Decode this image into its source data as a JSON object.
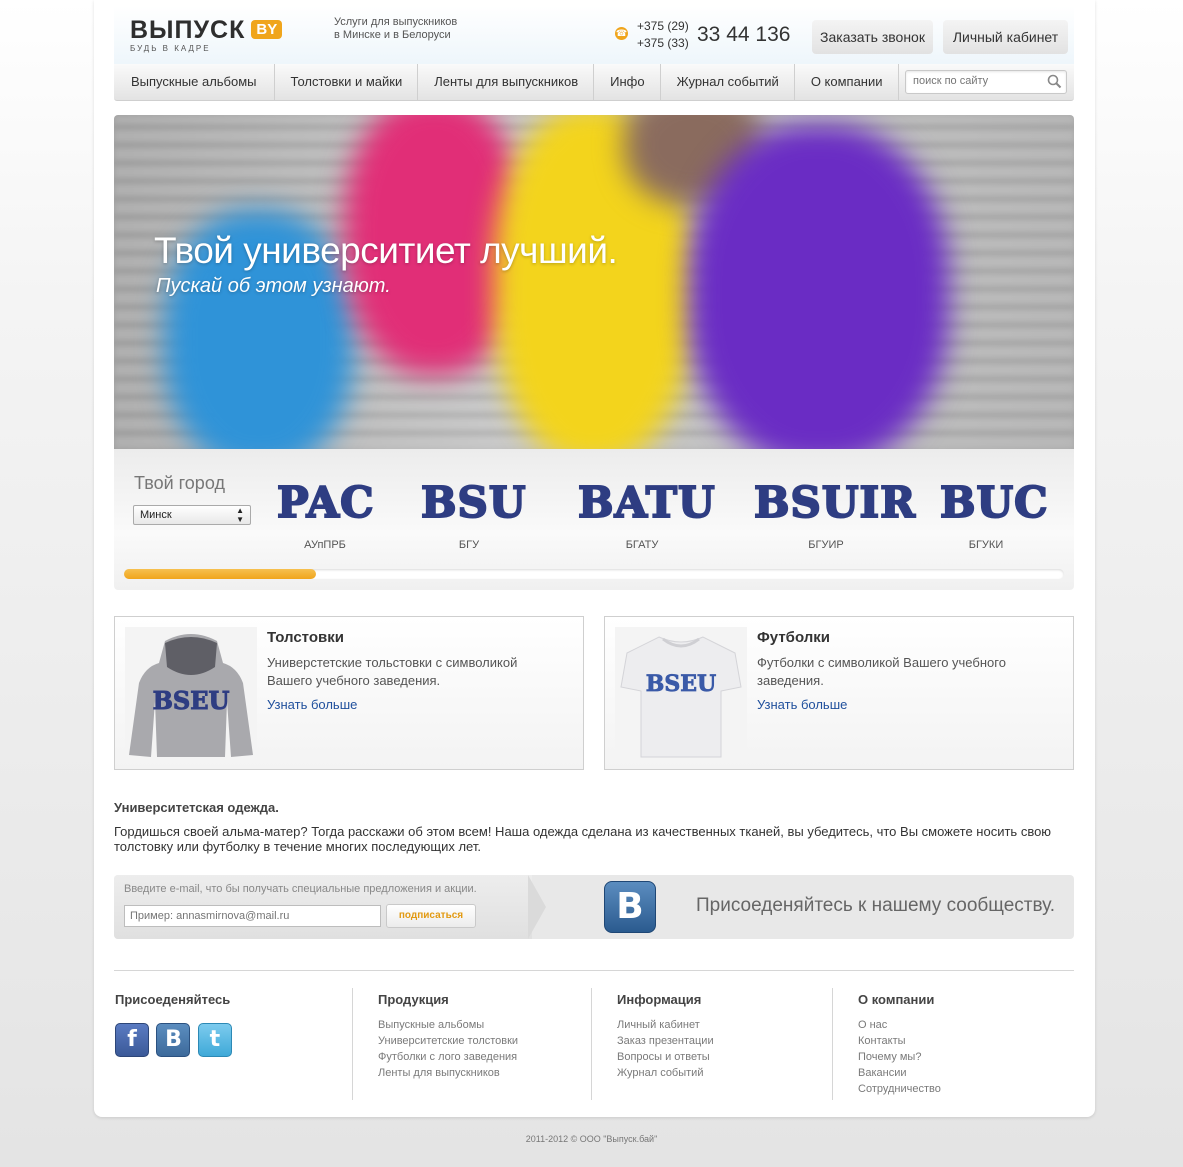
{
  "header": {
    "logo_main": "ВЫПУСК",
    "logo_badge": "BY",
    "logo_tagline": "БУДЬ В КАДРЕ",
    "services_line1": "Услуги для выпускников",
    "services_line2": "в Минске и в Белоруси",
    "phone_code1": "+375 (29)",
    "phone_code2": "+375 (33)",
    "phone_number": "33 44 136",
    "order_call_label": "Заказать звонок",
    "cabinet_label": "Личный кабинет"
  },
  "nav": {
    "items": [
      {
        "label": "Выпускные альбомы"
      },
      {
        "label": "Толстовки и майки"
      },
      {
        "label": "Ленты для выпускников"
      },
      {
        "label": "Инфо"
      },
      {
        "label": "Журнал событий"
      },
      {
        "label": "О компании"
      }
    ],
    "search_placeholder": "поиск по сайту"
  },
  "hero": {
    "title": "Твой университиет лучший.",
    "subtitle": "Пускай об этом узнают."
  },
  "city": {
    "label": "Твой город",
    "selected": "Минск",
    "universities": [
      {
        "logo": "PAC",
        "name": "АУпПРБ"
      },
      {
        "logo": "BSU",
        "name": "БГУ"
      },
      {
        "logo": "BATU",
        "name": "БГАТУ"
      },
      {
        "logo": "BSUIR",
        "name": "БГУИР"
      },
      {
        "logo": "BUC",
        "name": "БГУКИ"
      }
    ],
    "scroll_position": 0.2
  },
  "products": [
    {
      "title": "Толстовки",
      "desc": "Универстетские тольстовки с символикой Вашего учебного заведения.",
      "link": "Узнать больше",
      "print": "BSEU"
    },
    {
      "title": "Футболки",
      "desc": "Футболки с символикой Вашего учебного заведения.",
      "link": "Узнать больше",
      "print": "BSEU"
    }
  ],
  "about": {
    "heading": "Университетская одежда.",
    "text": "Гордишься своей альма-матер? Тогда расскажи об этом всем! Наша одежда сделана из качественных тканей, вы убедитесь, что Вы сможете носить свою толстовку или футболку в течение многих последующих лет."
  },
  "subscribe": {
    "prompt": "Введите e-mail, что бы получать специальные предложения и акции.",
    "placeholder": "Пример: annasmirnova@mail.ru",
    "button": "подписаться",
    "vk_letter": "B",
    "join_text": "Присоеденяйтесь к нашему сообществу."
  },
  "footer": {
    "social_heading": "Присоеденяйтесь",
    "social": [
      {
        "icon": "facebook-icon",
        "glyph": "f",
        "color": "#3b5998"
      },
      {
        "icon": "vk-icon",
        "glyph": "B",
        "color": "#3d6a9b"
      },
      {
        "icon": "twitter-icon",
        "glyph": "t",
        "color": "#3fa9d8"
      }
    ],
    "columns": [
      {
        "heading": "Продукция",
        "links": [
          "Выпускные альбомы",
          "Университетские толстовки",
          "Футболки с лого заведения",
          "Ленты для выпускников"
        ]
      },
      {
        "heading": "Информация",
        "links": [
          "Личный кабинет",
          "Заказ презентации",
          "Вопросы и ответы",
          "Журнал событий"
        ]
      },
      {
        "heading": "О компании",
        "links": [
          "О нас",
          "Контакты",
          "Почему мы?",
          "Вакансии",
          "Сотрудничество"
        ]
      }
    ],
    "copyright": "2011-2012 © ООО \"Выпуск.бай\""
  },
  "colors": {
    "accent": "#f0a51c",
    "uni_blue": "#2e3d82",
    "link": "#1f4f9c"
  }
}
